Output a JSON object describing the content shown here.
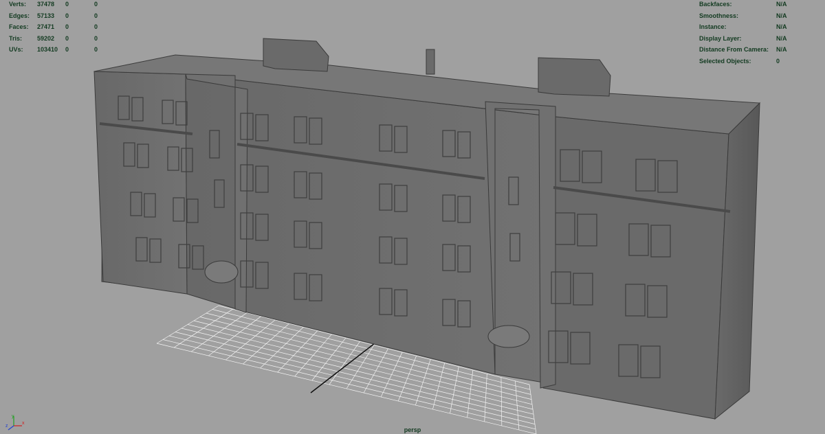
{
  "viewport": {
    "background": "#a0a0a0",
    "hud_color": "#123a20",
    "camera_name": "persp"
  },
  "poly_count": {
    "rows": [
      {
        "label": "Verts:",
        "values": [
          "37478",
          "0",
          "0"
        ]
      },
      {
        "label": "Edges:",
        "values": [
          "57133",
          "0",
          "0"
        ]
      },
      {
        "label": "Faces:",
        "values": [
          "27471",
          "0",
          "0"
        ]
      },
      {
        "label": "Tris:",
        "values": [
          "59202",
          "0",
          "0"
        ]
      },
      {
        "label": "UVs:",
        "values": [
          "103410",
          "0",
          "0"
        ]
      }
    ]
  },
  "object_details": {
    "rows": [
      {
        "label": "Backfaces:",
        "value": "N/A"
      },
      {
        "label": "Smoothness:",
        "value": "N/A"
      },
      {
        "label": "Instance:",
        "value": "N/A"
      },
      {
        "label": "Display Layer:",
        "value": "N/A"
      },
      {
        "label": "Distance From Camera:",
        "value": "N/A"
      },
      {
        "label": "Selected Objects:",
        "value": "0"
      }
    ]
  },
  "axis_gizmo": {
    "labels": [
      "y",
      "z",
      "x"
    ],
    "colors": {
      "x": "#d02020",
      "y": "#20a020",
      "z": "#2040d0"
    }
  },
  "scene": {
    "model_colors": {
      "front": "#6c6c6c",
      "side": "#5e5e5e",
      "roof": "#777777",
      "edge": "#3a3a3a"
    },
    "grid_color": "#ffffff",
    "grid_center_line_color": "#000000"
  }
}
